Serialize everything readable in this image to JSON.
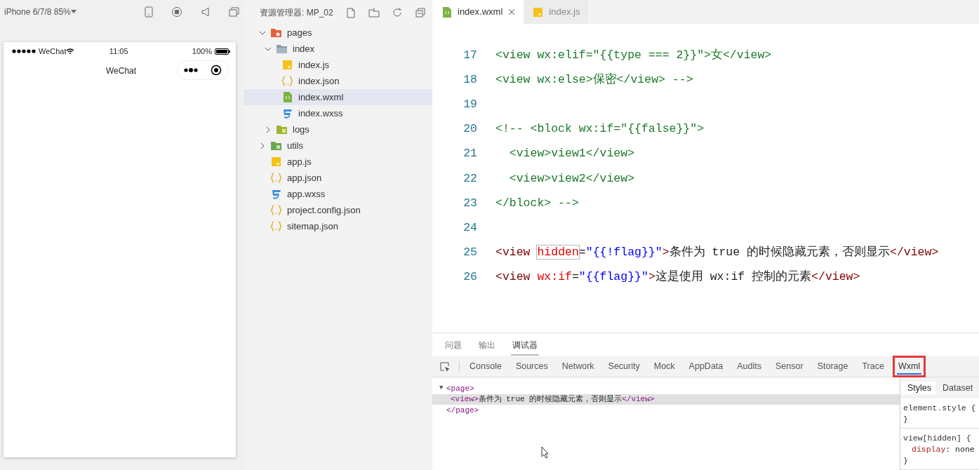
{
  "simulator": {
    "device": "iPhone 6/7/8 85%",
    "status": {
      "carrier": "WeChat",
      "time": "11:05",
      "battery": "100%"
    },
    "nav_title": "WeChat"
  },
  "explorer": {
    "title": "资源管理器: MP_02",
    "tree": [
      {
        "name": "pages",
        "kind": "folder-pages",
        "expanded": true,
        "selected": false,
        "children": [
          {
            "name": "index",
            "kind": "folder",
            "expanded": true,
            "selected": false,
            "children": [
              {
                "name": "index.js",
                "kind": "js",
                "selected": false
              },
              {
                "name": "index.json",
                "kind": "json",
                "selected": false
              },
              {
                "name": "index.wxml",
                "kind": "wxml",
                "selected": true
              },
              {
                "name": "index.wxss",
                "kind": "wxss",
                "selected": false
              }
            ]
          },
          {
            "name": "logs",
            "kind": "folder-logs",
            "expanded": false,
            "selected": false
          }
        ]
      },
      {
        "name": "utils",
        "kind": "folder-utils",
        "expanded": false,
        "selected": false
      },
      {
        "name": "app.js",
        "kind": "js",
        "selected": false
      },
      {
        "name": "app.json",
        "kind": "json",
        "selected": false
      },
      {
        "name": "app.wxss",
        "kind": "wxss",
        "selected": false
      },
      {
        "name": "project.config.json",
        "kind": "json",
        "selected": false
      },
      {
        "name": "sitemap.json",
        "kind": "json",
        "selected": false
      }
    ]
  },
  "editor": {
    "tabs": [
      {
        "label": "index.wxml",
        "kind": "wxml",
        "selected": true,
        "closable": true
      },
      {
        "label": "index.js",
        "kind": "js",
        "selected": false,
        "closable": false
      }
    ],
    "lines": [
      {
        "number": "17",
        "segments": [
          {
            "kind": "comment",
            "text": "<view wx:elif=\"{{type === 2}}\">女</view>"
          }
        ]
      },
      {
        "number": "18",
        "segments": [
          {
            "kind": "comment",
            "text": "<view wx:else>保密</view> -->"
          }
        ]
      },
      {
        "number": "19"
      },
      {
        "number": "20",
        "segments": [
          {
            "kind": "comment",
            "text": "<!-- <block wx:if=\"{{false}}\">"
          }
        ]
      },
      {
        "number": "21",
        "segments": [
          {
            "kind": "comment",
            "text": "  <view>view1</view>"
          }
        ]
      },
      {
        "number": "22",
        "segments": [
          {
            "kind": "comment",
            "text": "  <view>view2</view>"
          }
        ]
      },
      {
        "number": "23",
        "segments": [
          {
            "kind": "comment",
            "text": "</block> -->"
          }
        ]
      },
      {
        "number": "24"
      },
      {
        "number": "25",
        "segments": [
          {
            "kind": "tag",
            "text": "<view "
          },
          {
            "kind": "attr-marked",
            "text": "hidden"
          },
          {
            "kind": "plain",
            "text": "="
          },
          {
            "kind": "string",
            "text": "\"{{!flag}}\""
          },
          {
            "kind": "tag",
            "text": ">"
          },
          {
            "kind": "plain",
            "text": "条件为 true 的时候隐藏元素，否则显示"
          },
          {
            "kind": "tag",
            "text": "</view>"
          }
        ]
      },
      {
        "number": "26",
        "segments": [
          {
            "kind": "tag",
            "text": "<view "
          },
          {
            "kind": "attr",
            "text": "wx:if"
          },
          {
            "kind": "plain",
            "text": "="
          },
          {
            "kind": "string",
            "text": "\"{{flag}}\""
          },
          {
            "kind": "tag",
            "text": ">"
          },
          {
            "kind": "plain",
            "text": "这是使用 wx:if 控制的元素"
          },
          {
            "kind": "tag",
            "text": "</view>"
          }
        ]
      }
    ]
  },
  "debug": {
    "panel_tabs": [
      {
        "label": "问题",
        "selected": false
      },
      {
        "label": "输出",
        "selected": false
      },
      {
        "label": "调试器",
        "selected": true
      }
    ],
    "tool_tabs": [
      {
        "label": "Console",
        "selected": false,
        "highlighted": false
      },
      {
        "label": "Sources",
        "selected": false,
        "highlighted": false
      },
      {
        "label": "Network",
        "selected": false,
        "highlighted": false
      },
      {
        "label": "Security",
        "selected": false,
        "highlighted": false
      },
      {
        "label": "Mock",
        "selected": false,
        "highlighted": false
      },
      {
        "label": "AppData",
        "selected": false,
        "highlighted": false
      },
      {
        "label": "Audits",
        "selected": false,
        "highlighted": false
      },
      {
        "label": "Sensor",
        "selected": false,
        "highlighted": false
      },
      {
        "label": "Storage",
        "selected": false,
        "highlighted": false
      },
      {
        "label": "Trace",
        "selected": false,
        "highlighted": false
      },
      {
        "label": "Wxml",
        "selected": true,
        "highlighted": true
      }
    ],
    "tree": [
      {
        "toggle": "▼",
        "selected": false,
        "segments": [
          {
            "kind": "tag",
            "text": "<page>"
          }
        ]
      },
      {
        "selected": true,
        "segments": [
          {
            "kind": "tag",
            "text": "<view>"
          },
          {
            "kind": "plain",
            "text": "条件为 true 的时候隐藏元素，否则显示"
          },
          {
            "kind": "tag",
            "text": "</view>"
          }
        ]
      },
      {
        "selected": false,
        "segments": [
          {
            "kind": "tag",
            "text": "</page>"
          }
        ]
      }
    ],
    "style_tabs": [
      {
        "label": "Styles",
        "selected": true
      },
      {
        "label": "Dataset",
        "selected": false
      }
    ],
    "rules": [
      {
        "open": "element.style {",
        "close": "}"
      },
      {
        "open": "view[hidden] {",
        "declarations": [
          [
            {
              "kind": "prop",
              "text": "display"
            },
            {
              "kind": "plain",
              "text": ": none"
            }
          ]
        ],
        "close": "}"
      }
    ]
  }
}
